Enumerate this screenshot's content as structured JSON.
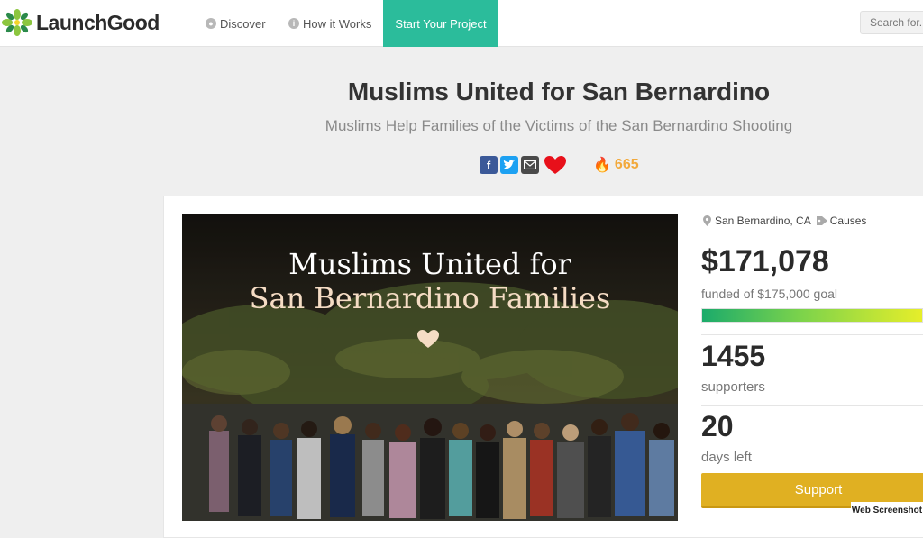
{
  "header": {
    "logo_text": "LaunchGood",
    "nav": [
      {
        "label": "Discover",
        "icon": "globe-icon"
      },
      {
        "label": "How it Works",
        "icon": "info-icon"
      }
    ],
    "cta_label": "Start Your Project",
    "search_placeholder": "Search for..."
  },
  "campaign": {
    "title": "Muslims United for San Bernardino",
    "subtitle": "Muslims Help Families of the Victims of the San Bernardino Shooting",
    "share_icons": [
      "facebook-icon",
      "twitter-icon",
      "email-icon",
      "heart-icon"
    ],
    "fire_count": "665",
    "hero": {
      "line1": "Muslims United for",
      "line2": "San Bernardino Families"
    },
    "location": "San Bernardino, CA",
    "category": "Causes",
    "raised": "$171,078",
    "goal_text": "funded of $175,000 goal",
    "progress_percent": 97.8,
    "supporters": "1455",
    "supporters_label": "supporters",
    "days_left": "20",
    "days_label": "days left",
    "support_button": "Support"
  },
  "watermark": "Web Screenshot",
  "colors": {
    "accent": "#2bbc9b",
    "fire": "#f2a93b",
    "support": "#e0b022",
    "facebook": "#3b5998",
    "twitter": "#1da1f2",
    "heart": "#e8101a"
  }
}
